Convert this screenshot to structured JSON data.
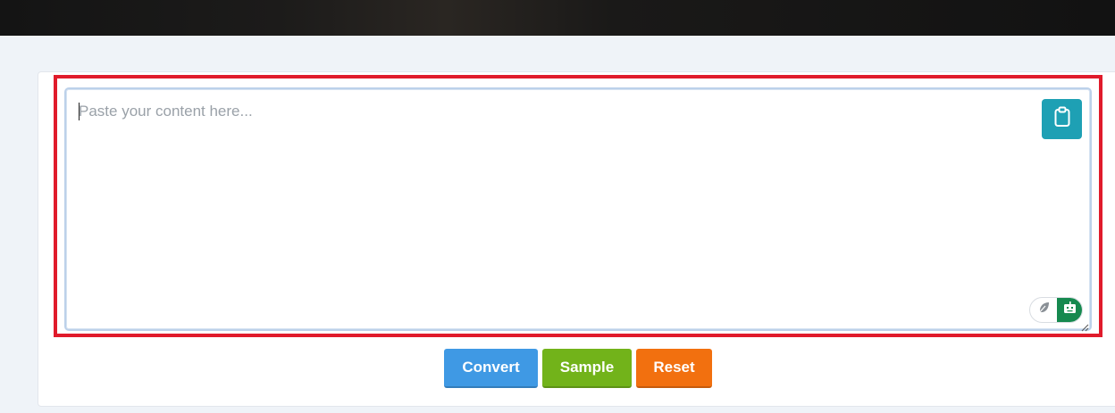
{
  "editor": {
    "placeholder": "Paste your content here..."
  },
  "buttons": {
    "convert": "Convert",
    "sample": "Sample",
    "reset": "Reset"
  },
  "icons": {
    "clipboard": "clipboard-icon",
    "feather": "feather-icon",
    "robot": "robot-icon"
  },
  "colors": {
    "highlight": "#e01b2b",
    "clipboard_button": "#1ea0b4",
    "convert": "#3f99e4",
    "sample": "#72b31a",
    "reset": "#f2700f",
    "toggle_active": "#16894f"
  }
}
